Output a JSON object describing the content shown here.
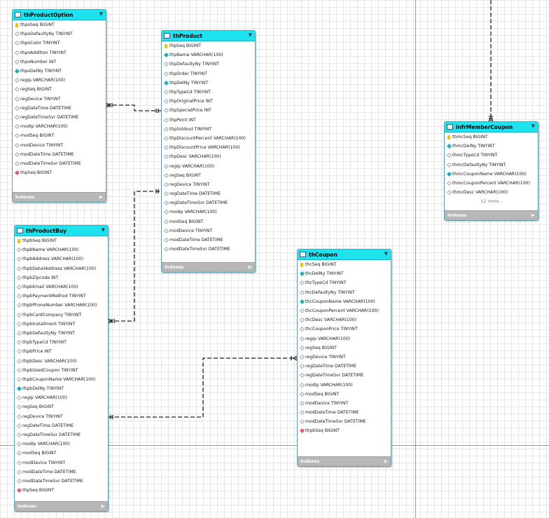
{
  "tables": {
    "thProductOption": {
      "name": "thProductOption",
      "columns": [
        {
          "text": "thpoSeq BIGINT",
          "key": "pk"
        },
        {
          "text": "thpoDefaultyNy TINYINT",
          "key": "col"
        },
        {
          "text": "thpoColor TINYINT",
          "key": "col"
        },
        {
          "text": "thpoAddition TINYINT",
          "key": "col"
        },
        {
          "text": "thpoNumber INT",
          "key": "col"
        },
        {
          "text": "thpoDelNy TINYINT",
          "key": "nn"
        },
        {
          "text": "regIp VARCHAR(100)",
          "key": "col"
        },
        {
          "text": "regSeq BIGINT",
          "key": "col"
        },
        {
          "text": "regDevice TINYINT",
          "key": "col"
        },
        {
          "text": "regDateTime DATETIME",
          "key": "col"
        },
        {
          "text": "regDateTimeSvr DATETIME",
          "key": "col"
        },
        {
          "text": "modIp VARCHAR(100)",
          "key": "col"
        },
        {
          "text": "modSeq BIGINT",
          "key": "col"
        },
        {
          "text": "modDevice TINYINT",
          "key": "col"
        },
        {
          "text": "modDateTime DATETIME",
          "key": "col"
        },
        {
          "text": "modDateTimeSvr DATETIME",
          "key": "col"
        },
        {
          "text": "thpSeq BIGINT",
          "key": "fk"
        }
      ],
      "footer": "Indexes"
    },
    "thProduct": {
      "name": "thProduct",
      "columns": [
        {
          "text": "thpSeq BIGINT",
          "key": "pk"
        },
        {
          "text": "thpName VARCHAR(100)",
          "key": "nn"
        },
        {
          "text": "thpDefaultyNy TINYINT",
          "key": "col"
        },
        {
          "text": "thpOrder TINYINT",
          "key": "col"
        },
        {
          "text": "thpDelNy TINYINT",
          "key": "nn"
        },
        {
          "text": "thpTypeCd TINYINT",
          "key": "col"
        },
        {
          "text": "thpOriginalPrice INT",
          "key": "col"
        },
        {
          "text": "thpSpecialPrice INT",
          "key": "col"
        },
        {
          "text": "thpPoint INT",
          "key": "col"
        },
        {
          "text": "thpSoldout TINYINT",
          "key": "col"
        },
        {
          "text": "thpDiscountPercent VARCHAR(100)",
          "key": "col"
        },
        {
          "text": "thpDiscountPrice VARCHAR(100)",
          "key": "col"
        },
        {
          "text": "thpDesc VARCHAR(100)",
          "key": "col"
        },
        {
          "text": "regIp VARCHAR(100)",
          "key": "col"
        },
        {
          "text": "regSeq BIGINT",
          "key": "col"
        },
        {
          "text": "regDevice TINYINT",
          "key": "col"
        },
        {
          "text": "regDateTime DATETIME",
          "key": "col"
        },
        {
          "text": "regDateTimeSvr DATETIME",
          "key": "col"
        },
        {
          "text": "modIp VARCHAR(100)",
          "key": "col"
        },
        {
          "text": "modSeq BIGINT",
          "key": "col"
        },
        {
          "text": "modDevice TINYINT",
          "key": "col"
        },
        {
          "text": "modDateTime DATETIME",
          "key": "col"
        },
        {
          "text": "modDateTimeSvr DATETIME",
          "key": "col"
        }
      ],
      "footer": "Indexes"
    },
    "thProductBuy": {
      "name": "thProductBuy",
      "columns": [
        {
          "text": "thpbSeq BIGINT",
          "key": "pk"
        },
        {
          "text": "thpbName VARCHAR(100)",
          "key": "col"
        },
        {
          "text": "thpbAddress VARCHAR(100)",
          "key": "col"
        },
        {
          "text": "thpbDetailAddress VARCHAR(100)",
          "key": "col"
        },
        {
          "text": "thpbZipcode INT",
          "key": "col"
        },
        {
          "text": "thpbEmail VARCHAR(100)",
          "key": "col"
        },
        {
          "text": "thpbPaymentMethod TINYINT",
          "key": "col"
        },
        {
          "text": "thpbPhoneNumber VARCHAR(100)",
          "key": "col"
        },
        {
          "text": "thpbCardCompany TINYINT",
          "key": "col"
        },
        {
          "text": "thpbInstallment TINYINT",
          "key": "col"
        },
        {
          "text": "thpbDefaultyNy TINYINT",
          "key": "col"
        },
        {
          "text": "thpbTypeCd TINYINT",
          "key": "col"
        },
        {
          "text": "thpbPrice INT",
          "key": "col"
        },
        {
          "text": "thpbDesc VARCHAR(100)",
          "key": "col"
        },
        {
          "text": "thpbUsedCoupon TINYINT",
          "key": "col"
        },
        {
          "text": "thpbCouponName VARCHAR(100)",
          "key": "col"
        },
        {
          "text": "thpbDelNy TINYINT",
          "key": "nn"
        },
        {
          "text": "regIp VARCHAR(100)",
          "key": "col"
        },
        {
          "text": "regSeq BIGINT",
          "key": "col"
        },
        {
          "text": "regDevice TINYINT",
          "key": "col"
        },
        {
          "text": "regDateTime DATETIME",
          "key": "col"
        },
        {
          "text": "regDateTimeSvr DATETIME",
          "key": "col"
        },
        {
          "text": "modIp VARCHAR(100)",
          "key": "col"
        },
        {
          "text": "modSeq BIGINT",
          "key": "col"
        },
        {
          "text": "modDevice TINYINT",
          "key": "col"
        },
        {
          "text": "modDateTime DATETIME",
          "key": "col"
        },
        {
          "text": "modDateTimeSvr DATETIME",
          "key": "col"
        },
        {
          "text": "thpSeq BIGINT",
          "key": "fk"
        }
      ],
      "footer": "Indexes"
    },
    "thCoupon": {
      "name": "thCoupon",
      "columns": [
        {
          "text": "thcSeq BIGINT",
          "key": "pk"
        },
        {
          "text": "thcDelNy TINYINT",
          "key": "nn"
        },
        {
          "text": "thcTypeCd TINYINT",
          "key": "col"
        },
        {
          "text": "thcDefaultyNy TINYINT",
          "key": "col"
        },
        {
          "text": "thcCouponName VARCHAR(100)",
          "key": "nn"
        },
        {
          "text": "thcCouponPercent VARCHAR(100)",
          "key": "col"
        },
        {
          "text": "thcDesc VARCHAR(100)",
          "key": "col"
        },
        {
          "text": "thcCouponPrice TINYINT",
          "key": "col"
        },
        {
          "text": "regIp VARCHAR(100)",
          "key": "col"
        },
        {
          "text": "regSeq BIGINT",
          "key": "col"
        },
        {
          "text": "regDevice TINYINT",
          "key": "col"
        },
        {
          "text": "regDateTime DATETIME",
          "key": "col"
        },
        {
          "text": "regDateTimeSvr DATETIME",
          "key": "col"
        },
        {
          "text": "modIp VARCHAR(100)",
          "key": "col"
        },
        {
          "text": "modSeq BIGINT",
          "key": "col"
        },
        {
          "text": "modDevice TINYINT",
          "key": "col"
        },
        {
          "text": "modDateTime DATETIME",
          "key": "col"
        },
        {
          "text": "modDateTimeSvr DATETIME",
          "key": "col"
        },
        {
          "text": "thpbSeq BIGINT",
          "key": "fk"
        }
      ],
      "footer": "Indexes"
    },
    "infrMemberCoupon": {
      "name": "infrMemberCoupon",
      "columns": [
        {
          "text": "thmcSeq BIGINT",
          "key": "pk"
        },
        {
          "text": "thmcDelNy TINYINT",
          "key": "nn"
        },
        {
          "text": "thmcTypeCd TINYINT",
          "key": "col"
        },
        {
          "text": "thmcDefaultyNy TINYINT",
          "key": "col"
        },
        {
          "text": "thmcCouponName VARCHAR(100)",
          "key": "nn"
        },
        {
          "text": "thmcCouponPercent VARCHAR(100)",
          "key": "col"
        },
        {
          "text": "thmcDesc VARCHAR(100)",
          "key": "col"
        }
      ],
      "more": "12 more...",
      "footer": "Indexes"
    }
  },
  "colors": {
    "header": "#1ee3ef",
    "footer": "#b7b7b7",
    "connector": "#222222",
    "pk_key": "#e8c21a",
    "nn_key": "#29a8b6",
    "fk_key": "#e0606a"
  }
}
